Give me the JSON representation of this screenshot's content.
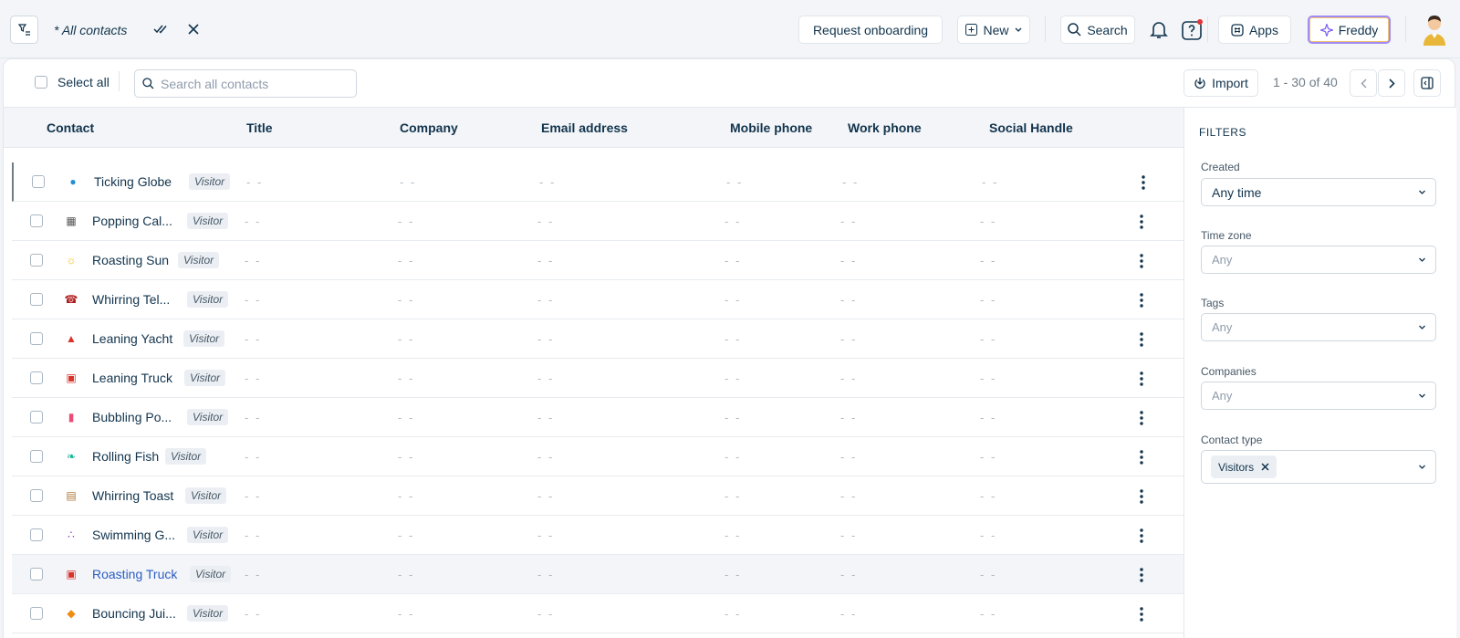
{
  "topbar": {
    "view_title": "* All contacts",
    "request_onboarding": "Request onboarding",
    "new_label": "New",
    "search_label": "Search",
    "apps_label": "Apps",
    "freddy_label": "Freddy"
  },
  "toolbar": {
    "select_all": "Select all",
    "search_placeholder": "Search all contacts",
    "import_label": "Import",
    "pagination": "1 - 30 of 40"
  },
  "table": {
    "columns": [
      "Contact",
      "Title",
      "Company",
      "Email address",
      "Mobile phone",
      "Work phone",
      "Social Handle"
    ],
    "empty_value": "- -",
    "rows": [
      {
        "name": "Ticking Globe",
        "badge": "Visitor",
        "icon": "globe-icon"
      },
      {
        "name": "Popping Cal...",
        "badge": "Visitor",
        "icon": "calculator-icon"
      },
      {
        "name": "Roasting Sun",
        "badge": "Visitor",
        "icon": "sun-icon"
      },
      {
        "name": "Whirring Tel...",
        "badge": "Visitor",
        "icon": "telephone-icon"
      },
      {
        "name": "Leaning Yacht",
        "badge": "Visitor",
        "icon": "sailboat-icon"
      },
      {
        "name": "Leaning Truck",
        "badge": "Visitor",
        "icon": "truck-icon"
      },
      {
        "name": "Bubbling Po...",
        "badge": "Visitor",
        "icon": "popsicle-icon"
      },
      {
        "name": "Rolling Fish",
        "badge": "Visitor",
        "icon": "fish-icon"
      },
      {
        "name": "Whirring Toast",
        "badge": "Visitor",
        "icon": "toast-icon"
      },
      {
        "name": "Swimming G...",
        "badge": "Visitor",
        "icon": "grapes-icon"
      },
      {
        "name": "Roasting Truck",
        "badge": "Visitor",
        "icon": "truck-icon"
      },
      {
        "name": "Bouncing Jui...",
        "badge": "Visitor",
        "icon": "juice-icon"
      }
    ]
  },
  "filters": {
    "title": "FILTERS",
    "created_label": "Created",
    "created_value": "Any time",
    "timezone_label": "Time zone",
    "timezone_placeholder": "Any",
    "tags_label": "Tags",
    "tags_placeholder": "Any",
    "companies_label": "Companies",
    "companies_placeholder": "Any",
    "contact_type_label": "Contact type",
    "contact_type_chip": "Visitors"
  },
  "colors": {
    "accent_blue": "#2c5cc5",
    "freddy_purple": "#7b5cf0",
    "text_primary": "#12344d"
  }
}
